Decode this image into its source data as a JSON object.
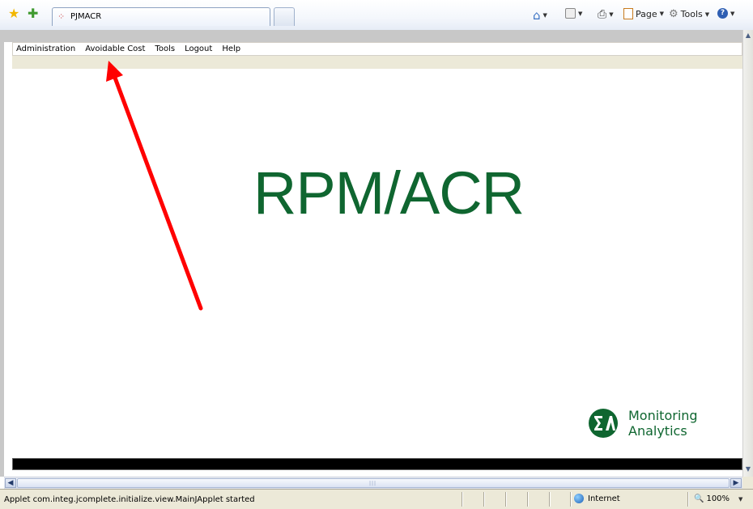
{
  "browser": {
    "tab_title": "PJMACR",
    "commands": {
      "page_label": "Page",
      "tools_label": "Tools"
    }
  },
  "applet": {
    "menu": [
      "Administration",
      "Avoidable Cost",
      "Tools",
      "Logout",
      "Help"
    ],
    "hero_title": "RPM/ACR",
    "logo": {
      "line1": "Monitoring",
      "line2": "Analytics"
    }
  },
  "status_bar": {
    "message": "Applet com.integ.jcomplete.initialize.view.MainJApplet started",
    "zone": "Internet",
    "zoom": "100%"
  },
  "colors": {
    "brand_green": "#0f6630",
    "annotation_arrow": "#ff0000"
  },
  "icons": [
    "favorites-star-icon",
    "add-favorites-icon",
    "loading-spinner-icon",
    "home-icon",
    "feeds-icon",
    "print-icon",
    "page-icon",
    "tools-gear-icon",
    "help-icon",
    "globe-icon",
    "zoom-magnifier-icon"
  ]
}
